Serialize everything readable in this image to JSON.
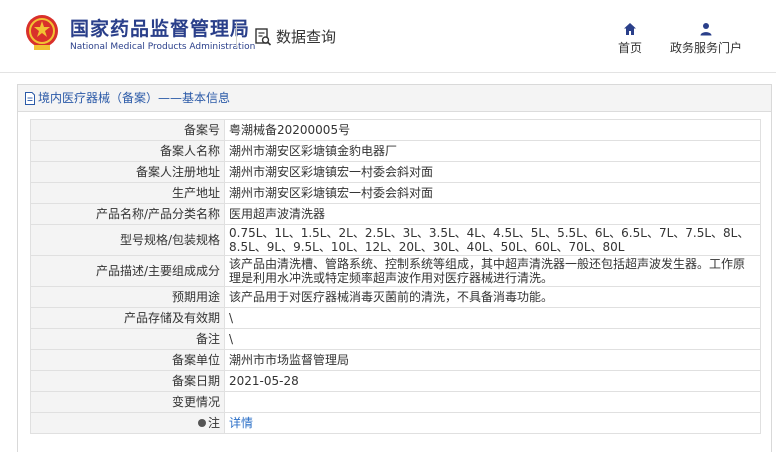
{
  "header": {
    "org_name_cn": "国家药品监督管理局",
    "org_name_en": "National Medical Products Administration",
    "query_label": "数据查询",
    "nav": [
      {
        "label": "首页",
        "icon": "home-icon"
      },
      {
        "label": "政务服务门户",
        "icon": "user-icon"
      }
    ]
  },
  "panel": {
    "title": "境内医疗器械（备案）——基本信息"
  },
  "rows": [
    {
      "label": "备案号",
      "value": "粤潮械备20200005号"
    },
    {
      "label": "备案人名称",
      "value": "潮州市潮安区彩塘镇金豹电器厂"
    },
    {
      "label": "备案人注册地址",
      "value": "潮州市潮安区彩塘镇宏一村委会斜对面"
    },
    {
      "label": "生产地址",
      "value": "潮州市潮安区彩塘镇宏一村委会斜对面"
    },
    {
      "label": "产品名称/产品分类名称",
      "value": "医用超声波清洗器"
    },
    {
      "label": "型号规格/包装规格",
      "value": "0.75L、1L、1.5L、2L、2.5L、3L、3.5L、4L、4.5L、5L、5.5L、6L、6.5L、7L、7.5L、8L、8.5L、9L、9.5L、10L、12L、20L、30L、40L、50L、60L、70L、80L"
    },
    {
      "label": "产品描述/主要组成成分",
      "value": "该产品由清洗槽、管路系统、控制系统等组成，其中超声清洗器一般还包括超声波发生器。工作原理是利用水冲洗或特定频率超声波作用对医疗器械进行清洗。"
    },
    {
      "label": "预期用途",
      "value": "该产品用于对医疗器械消毒灭菌前的清洗，不具备消毒功能。"
    },
    {
      "label": "产品存储及有效期",
      "value": "\\"
    },
    {
      "label": "备注",
      "value": "\\"
    },
    {
      "label": "备案单位",
      "value": "潮州市市场监督管理局"
    },
    {
      "label": "备案日期",
      "value": "2021-05-28"
    },
    {
      "label": "变更情况",
      "value": ""
    },
    {
      "label": "注",
      "value": "详情"
    }
  ],
  "colors": {
    "brand": "#2a3f8a",
    "link": "#2b6fc7",
    "label_bg": "#f4f4f4"
  }
}
